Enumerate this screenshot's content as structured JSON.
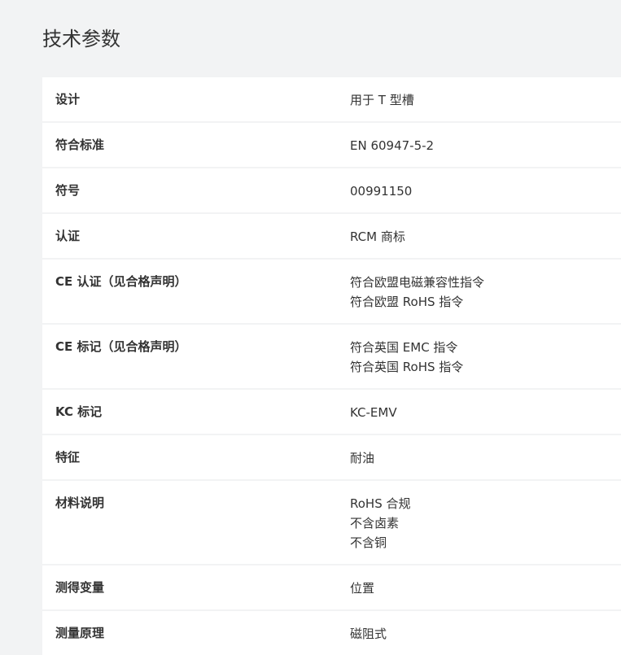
{
  "page": {
    "title": "技术参数"
  },
  "rows": [
    {
      "label": "设计",
      "values": [
        "用于 T 型槽"
      ]
    },
    {
      "label": "符合标准",
      "values": [
        "EN 60947-5-2"
      ]
    },
    {
      "label": "符号",
      "values": [
        "00991150"
      ]
    },
    {
      "label": "认证",
      "values": [
        "RCM 商标"
      ]
    },
    {
      "label": "CE 认证（见合格声明）",
      "values": [
        "符合欧盟电磁兼容性指令",
        "符合欧盟 RoHS 指令"
      ]
    },
    {
      "label": "CE 标记（见合格声明）",
      "values": [
        "符合英国 EMC 指令",
        "符合英国 RoHS 指令"
      ]
    },
    {
      "label": "KC 标记",
      "values": [
        "KC-EMV"
      ]
    },
    {
      "label": "特征",
      "values": [
        "耐油"
      ]
    },
    {
      "label": "材料说明",
      "values": [
        "RoHS 合规",
        "不含卤素",
        "不含铜"
      ]
    },
    {
      "label": "测得变量",
      "values": [
        "位置"
      ]
    },
    {
      "label": "测量原理",
      "values": [
        "磁阻式"
      ]
    }
  ]
}
